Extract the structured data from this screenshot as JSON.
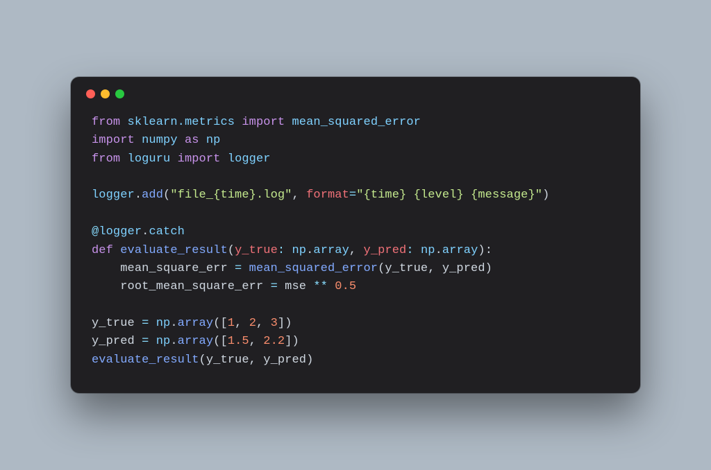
{
  "code": {
    "l1_from": "from",
    "l1_mod": "sklearn.metrics",
    "l1_import": "import",
    "l1_name": "mean_squared_error",
    "l2_import": "import",
    "l2_mod": "numpy",
    "l2_as": "as",
    "l2_alias": "np",
    "l3_from": "from",
    "l3_mod": "loguru",
    "l3_import": "import",
    "l3_name": "logger",
    "l5_obj": "logger",
    "l5_dot": ".",
    "l5_fn": "add",
    "l5_lp": "(",
    "l5_s1": "\"file_{time}.log\"",
    "l5_comma": ", ",
    "l5_kw": "format",
    "l5_eq": "=",
    "l5_s2": "\"{time} {level} {message}\"",
    "l5_rp": ")",
    "l7_at": "@",
    "l7_obj": "logger",
    "l7_dot": ".",
    "l7_attr": "catch",
    "l8_def": "def",
    "l8_fn": "evaluate_result",
    "l8_lp": "(",
    "l8_p1": "y_true",
    "l8_c1": ": ",
    "l8_t1a": "np",
    "l8_t1d": ".",
    "l8_t1b": "array",
    "l8_cm": ", ",
    "l8_p2": "y_pred",
    "l8_c2": ": ",
    "l8_t2a": "np",
    "l8_t2d": ".",
    "l8_t2b": "array",
    "l8_rp": "):",
    "l9_ind": "    ",
    "l9_v": "mean_square_err",
    "l9_eq": " = ",
    "l9_fn": "mean_squared_error",
    "l9_lp": "(",
    "l9_a1": "y_true",
    "l9_cm": ", ",
    "l9_a2": "y_pred",
    "l9_rp": ")",
    "l10_ind": "    ",
    "l10_v": "root_mean_square_err",
    "l10_eq": " = ",
    "l10_r": "mse",
    "l10_op": " ** ",
    "l10_n": "0.5",
    "l12_v": "y_true",
    "l12_eq": " = ",
    "l12_np": "np",
    "l12_d": ".",
    "l12_fn": "array",
    "l12_lp": "([",
    "l12_n1": "1",
    "l12_c1": ", ",
    "l12_n2": "2",
    "l12_c2": ", ",
    "l12_n3": "3",
    "l12_rp": "])",
    "l13_v": "y_pred",
    "l13_eq": " = ",
    "l13_np": "np",
    "l13_d": ".",
    "l13_fn": "array",
    "l13_lp": "([",
    "l13_n1": "1.5",
    "l13_c1": ", ",
    "l13_n2": "2.2",
    "l13_rp": "])",
    "l14_fn": "evaluate_result",
    "l14_lp": "(",
    "l14_a1": "y_true",
    "l14_cm": ", ",
    "l14_a2": "y_pred",
    "l14_rp": ")"
  }
}
